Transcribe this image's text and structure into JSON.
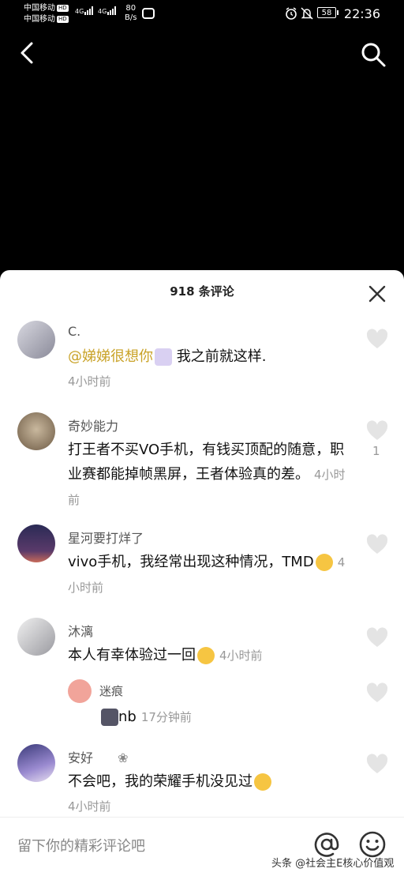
{
  "status_bar": {
    "carrier1": "中国移动",
    "carrier2": "中国移动",
    "hd": "HD",
    "net1": "4G",
    "net2": "4G",
    "speed_value": "80",
    "speed_unit": "B/s",
    "battery": "58",
    "time": "22:36"
  },
  "sheet": {
    "title": "918 条评论"
  },
  "comments": [
    {
      "user": "C.",
      "mention": "@娣娣很想你",
      "text": " 我之前就这样.",
      "time": "4小时前"
    },
    {
      "user": "奇妙能力",
      "text": "打王者不买VO手机，有钱买顶配的随意，职业赛都能掉帧黑屏，王者体验真的差。",
      "time": "4小时前",
      "likes": "1"
    },
    {
      "user": "星河要打烊了",
      "text": "vivo手机，我经常出现这种情况，TMD",
      "time": "4小时前"
    },
    {
      "user": "沐漓",
      "text": "本人有幸体验过一回",
      "time": "4小时前"
    },
    {
      "user": "迷痕",
      "text": "nb",
      "time": "17分钟前"
    },
    {
      "user": "安好",
      "user_badge": "❀",
      "text": "不会吧，我的荣耀手机没见过",
      "time": "4小时前"
    }
  ],
  "input": {
    "placeholder": "留下你的精彩评论吧"
  },
  "watermark": "头条 @社会主E核心价值观",
  "colors": {
    "mention": "#c9a227",
    "background": "#000000",
    "sheet": "#ffffff"
  },
  "icons": [
    "back-arrow-icon",
    "search-icon",
    "close-icon",
    "heart-icon",
    "at-icon",
    "emoji-icon",
    "alarm-icon",
    "mute-icon"
  ]
}
